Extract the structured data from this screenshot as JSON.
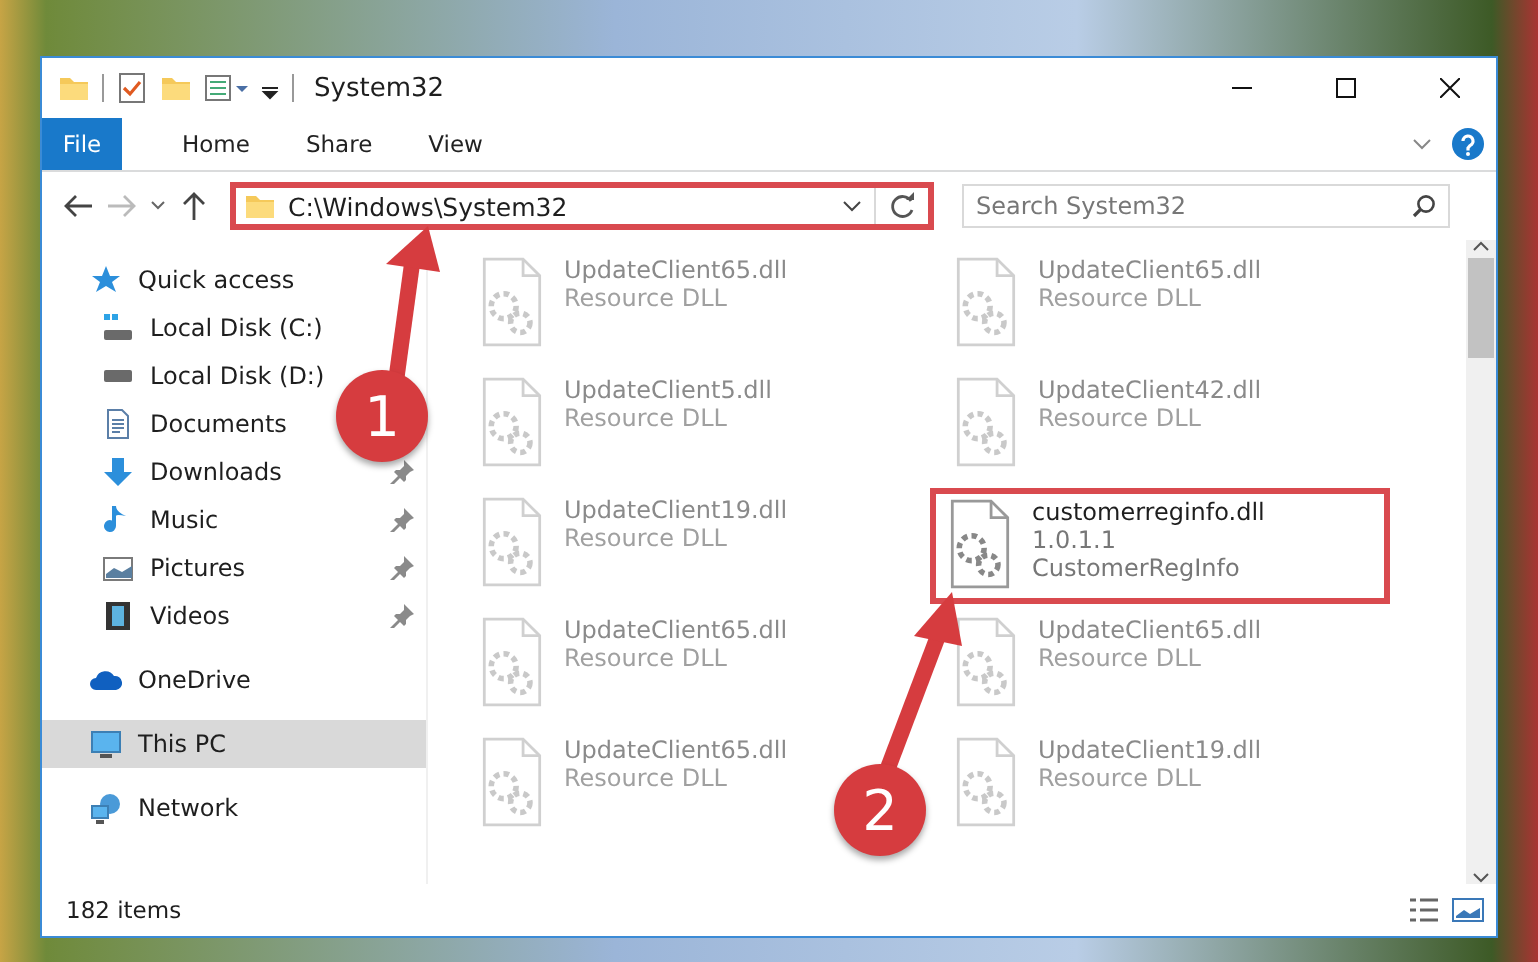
{
  "window": {
    "title": "System32"
  },
  "ribbon_tabs": [
    {
      "label": "File",
      "selected": true
    },
    {
      "label": "Home",
      "selected": false
    },
    {
      "label": "Share",
      "selected": false
    },
    {
      "label": "View",
      "selected": false
    }
  ],
  "address_bar": {
    "path": "C:\\Windows\\System32",
    "highlighted": true
  },
  "search": {
    "placeholder": "Search System32"
  },
  "sidebar": {
    "items": [
      {
        "label": "Quick access",
        "kind": "star",
        "selected": false,
        "children": [
          {
            "label": "Local Disk (C:)",
            "kind": "system-drive",
            "pinned": false,
            "selected": false
          },
          {
            "label": "Local Disk (D:)",
            "kind": "drive",
            "pinned": false,
            "selected": false
          },
          {
            "label": "Documents",
            "kind": "documents",
            "pinned": false,
            "selected": false
          },
          {
            "label": "Downloads",
            "kind": "downloads",
            "pinned": true,
            "selected": false
          },
          {
            "label": "Music",
            "kind": "music",
            "pinned": true,
            "selected": false
          },
          {
            "label": "Pictures",
            "kind": "pictures",
            "pinned": true,
            "selected": false
          },
          {
            "label": "Videos",
            "kind": "videos",
            "pinned": true,
            "selected": false
          }
        ]
      },
      {
        "label": "OneDrive",
        "kind": "cloud",
        "selected": false
      },
      {
        "label": "This PC",
        "kind": "pc",
        "selected": true
      },
      {
        "label": "Network",
        "kind": "network",
        "selected": false
      }
    ]
  },
  "files": [
    {
      "name": "UpdateClient65.dll",
      "lines": [
        "Resource DLL"
      ],
      "dimmed": true,
      "highlighted": false
    },
    {
      "name": "UpdateClient65.dll",
      "lines": [
        "Resource DLL"
      ],
      "dimmed": true,
      "highlighted": false
    },
    {
      "name": "UpdateClient5.dll",
      "lines": [
        "Resource DLL"
      ],
      "dimmed": true,
      "highlighted": false
    },
    {
      "name": "UpdateClient42.dll",
      "lines": [
        "Resource DLL"
      ],
      "dimmed": true,
      "highlighted": false
    },
    {
      "name": "UpdateClient19.dll",
      "lines": [
        "Resource DLL"
      ],
      "dimmed": true,
      "highlighted": false
    },
    {
      "name": "customerreginfo.dll",
      "lines": [
        "1.0.1.1",
        "CustomerRegInfo"
      ],
      "dimmed": false,
      "highlighted": true
    },
    {
      "name": "UpdateClient65.dll",
      "lines": [
        "Resource DLL"
      ],
      "dimmed": true,
      "highlighted": false
    },
    {
      "name": "UpdateClient65.dll",
      "lines": [
        "Resource DLL"
      ],
      "dimmed": true,
      "highlighted": false
    },
    {
      "name": "UpdateClient65.dll",
      "lines": [
        "Resource DLL"
      ],
      "dimmed": true,
      "highlighted": false
    },
    {
      "name": "UpdateClient19.dll",
      "lines": [
        "Resource DLL"
      ],
      "dimmed": true,
      "highlighted": false
    }
  ],
  "status_bar": {
    "item_count": "182 items"
  },
  "callouts": [
    {
      "number": "1"
    },
    {
      "number": "2"
    }
  ]
}
